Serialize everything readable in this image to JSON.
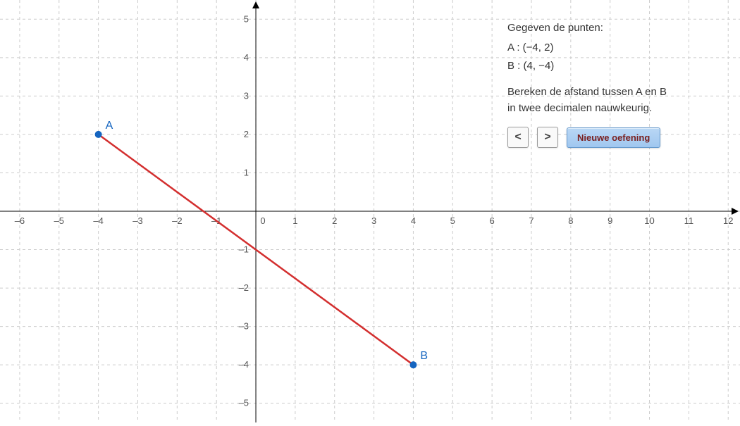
{
  "chart_data": {
    "type": "scatter",
    "title": "",
    "xlabel": "",
    "ylabel": "",
    "xlim": [
      -6.5,
      12.3
    ],
    "ylim": [
      -5.5,
      5.5
    ],
    "xticks": [
      -6,
      -5,
      -4,
      -3,
      -2,
      -1,
      0,
      1,
      2,
      3,
      4,
      5,
      6,
      7,
      8,
      9,
      10,
      11,
      12
    ],
    "yticks": [
      -5,
      -4,
      -3,
      -2,
      -1,
      1,
      2,
      3,
      4,
      5
    ],
    "grid": true,
    "points": [
      {
        "name": "A",
        "x": -4,
        "y": 2
      },
      {
        "name": "B",
        "x": 4,
        "y": -4
      }
    ],
    "lines": [
      {
        "from": "A",
        "to": "B",
        "color": "#d32f2f"
      }
    ]
  },
  "info": {
    "given_label": "Gegeven de punten:",
    "point_a_label": "A : (−4, 2)",
    "point_b_label": "B : (4, −4)",
    "question_line1": "Bereken de afstand tussen A en B",
    "question_line2": "in twee decimalen nauwkeurig."
  },
  "controls": {
    "prev_label": "<",
    "next_label": ">",
    "new_exercise_label": "Nieuwe oefening"
  }
}
